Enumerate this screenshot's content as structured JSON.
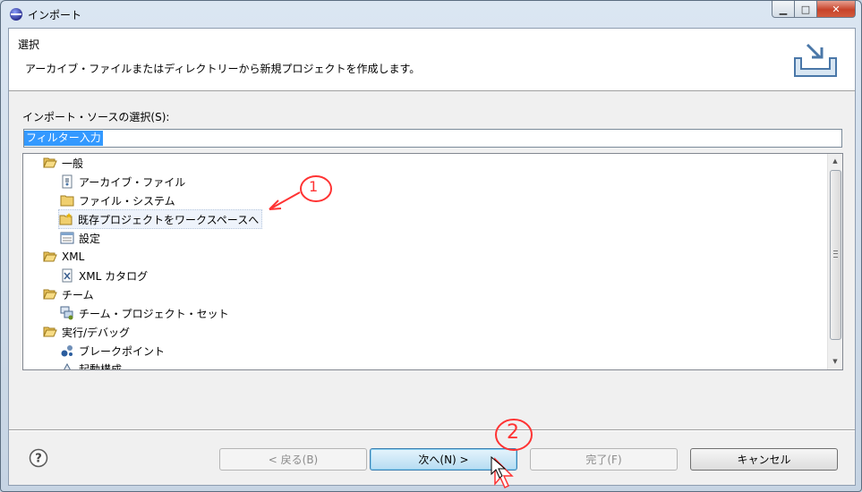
{
  "window": {
    "title": "インポート",
    "controls": {
      "minimize": "▁",
      "maximize": "□",
      "close": "✕"
    }
  },
  "banner": {
    "title": "選択",
    "description": "アーカイブ・ファイルまたはディレクトリーから新規プロジェクトを作成します。"
  },
  "source": {
    "label": "インポート・ソースの選択(S):",
    "filter_value": "フィルター入力"
  },
  "tree": {
    "items": [
      {
        "label": "一般",
        "icon": "folder-open-icon",
        "level": 0
      },
      {
        "label": "アーカイブ・ファイル",
        "icon": "archive-file-icon",
        "level": 1
      },
      {
        "label": "ファイル・システム",
        "icon": "folder-icon",
        "level": 1
      },
      {
        "label": "既存プロジェクトをワークスペースへ",
        "icon": "project-icon",
        "level": 1,
        "highlighted": true
      },
      {
        "label": "設定",
        "icon": "preferences-icon",
        "level": 1
      },
      {
        "label": "XML",
        "icon": "folder-open-icon",
        "level": 0
      },
      {
        "label": "XML カタログ",
        "icon": "xml-file-icon",
        "level": 1
      },
      {
        "label": "チーム",
        "icon": "folder-open-icon",
        "level": 0
      },
      {
        "label": "チーム・プロジェクト・セット",
        "icon": "team-icon",
        "level": 1
      },
      {
        "label": "実行/デバッグ",
        "icon": "folder-open-icon",
        "level": 0
      },
      {
        "label": "ブレークポイント",
        "icon": "breakpoint-icon",
        "level": 1
      },
      {
        "label": "起動構成",
        "icon": "launch-icon",
        "level": 1
      }
    ]
  },
  "buttons": {
    "back": "< 戻る(B)",
    "next": "次へ(N) >",
    "finish": "完了(F)",
    "cancel": "キャンセル"
  },
  "annotations": {
    "one": "1",
    "two": "2"
  },
  "colors": {
    "annotation": "#ff3333",
    "selection": "#3399ff"
  }
}
